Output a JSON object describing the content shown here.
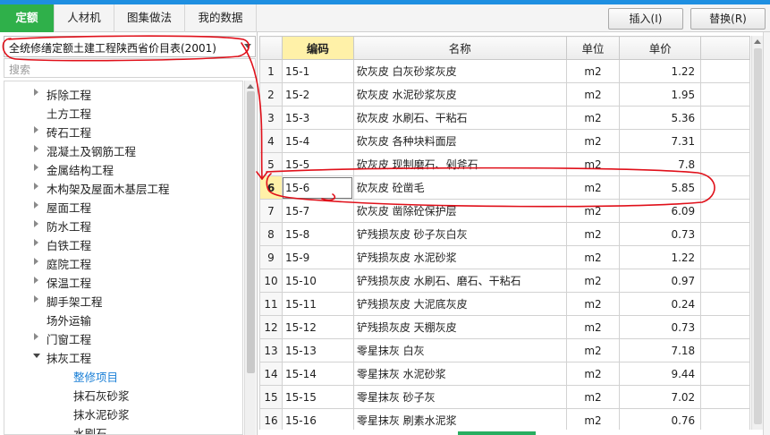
{
  "tabs": [
    {
      "label": "定额",
      "active": true
    },
    {
      "label": "人材机",
      "active": false
    },
    {
      "label": "图集做法",
      "active": false
    },
    {
      "label": "我的数据",
      "active": false
    }
  ],
  "buttons": {
    "insert": "插入(I)",
    "replace": "替换(R)"
  },
  "quota_book": "全统修缮定额土建工程陕西省价目表(2001)",
  "search_placeholder": "搜索",
  "tree": [
    {
      "label": "拆除工程",
      "children": true,
      "expanded": false,
      "level": 0
    },
    {
      "label": "土方工程",
      "children": false,
      "expanded": false,
      "level": 0
    },
    {
      "label": "砖石工程",
      "children": true,
      "expanded": false,
      "level": 0
    },
    {
      "label": "混凝土及钢筋工程",
      "children": true,
      "expanded": false,
      "level": 0
    },
    {
      "label": "金属结构工程",
      "children": true,
      "expanded": false,
      "level": 0
    },
    {
      "label": "木构架及屋面木基层工程",
      "children": true,
      "expanded": false,
      "level": 0
    },
    {
      "label": "屋面工程",
      "children": true,
      "expanded": false,
      "level": 0
    },
    {
      "label": "防水工程",
      "children": true,
      "expanded": false,
      "level": 0
    },
    {
      "label": "白铁工程",
      "children": true,
      "expanded": false,
      "level": 0
    },
    {
      "label": "庭院工程",
      "children": true,
      "expanded": false,
      "level": 0
    },
    {
      "label": "保温工程",
      "children": true,
      "expanded": false,
      "level": 0
    },
    {
      "label": "脚手架工程",
      "children": true,
      "expanded": false,
      "level": 0
    },
    {
      "label": "场外运输",
      "children": false,
      "expanded": false,
      "level": 0
    },
    {
      "label": "门窗工程",
      "children": true,
      "expanded": false,
      "level": 0
    },
    {
      "label": "抹灰工程",
      "children": true,
      "expanded": true,
      "level": 0
    },
    {
      "label": "整修项目",
      "children": false,
      "expanded": false,
      "level": 1,
      "selected": true
    },
    {
      "label": "抹石灰砂浆",
      "children": false,
      "expanded": false,
      "level": 1
    },
    {
      "label": "抹水泥砂浆",
      "children": false,
      "expanded": false,
      "level": 1
    },
    {
      "label": "水刷石",
      "children": false,
      "expanded": false,
      "level": 1
    }
  ],
  "table": {
    "headers": {
      "code": "编码",
      "name": "名称",
      "unit": "单位",
      "price": "单价"
    },
    "selected_row": 6,
    "rows": [
      {
        "n": "1",
        "code": "15-1",
        "name": "砍灰皮 白灰砂浆灰皮",
        "unit": "m2",
        "price": "1.22"
      },
      {
        "n": "2",
        "code": "15-2",
        "name": "砍灰皮 水泥砂浆灰皮",
        "unit": "m2",
        "price": "1.95"
      },
      {
        "n": "3",
        "code": "15-3",
        "name": "砍灰皮 水刷石、干粘石",
        "unit": "m2",
        "price": "5.36"
      },
      {
        "n": "4",
        "code": "15-4",
        "name": "砍灰皮 各种块料面层",
        "unit": "m2",
        "price": "7.31"
      },
      {
        "n": "5",
        "code": "15-5",
        "name": "砍灰皮 现制磨石、剁斧石",
        "unit": "m2",
        "price": "7.8"
      },
      {
        "n": "6",
        "code": "15-6",
        "name": "砍灰皮 砼凿毛",
        "unit": "m2",
        "price": "5.85"
      },
      {
        "n": "7",
        "code": "15-7",
        "name": "砍灰皮 凿除砼保护层",
        "unit": "m2",
        "price": "6.09"
      },
      {
        "n": "8",
        "code": "15-8",
        "name": "铲残损灰皮 砂子灰白灰",
        "unit": "m2",
        "price": "0.73"
      },
      {
        "n": "9",
        "code": "15-9",
        "name": "铲残损灰皮 水泥砂浆",
        "unit": "m2",
        "price": "1.22"
      },
      {
        "n": "10",
        "code": "15-10",
        "name": "铲残损灰皮 水刷石、磨石、干粘石",
        "unit": "m2",
        "price": "0.97"
      },
      {
        "n": "11",
        "code": "15-11",
        "name": "铲残损灰皮 大泥底灰皮",
        "unit": "m2",
        "price": "0.24"
      },
      {
        "n": "12",
        "code": "15-12",
        "name": "铲残损灰皮 天棚灰皮",
        "unit": "m2",
        "price": "0.73"
      },
      {
        "n": "13",
        "code": "15-13",
        "name": "零星抹灰 白灰",
        "unit": "m2",
        "price": "7.18"
      },
      {
        "n": "14",
        "code": "15-14",
        "name": "零星抹灰 水泥砂浆",
        "unit": "m2",
        "price": "9.44"
      },
      {
        "n": "15",
        "code": "15-15",
        "name": "零星抹灰 砂子灰",
        "unit": "m2",
        "price": "7.02"
      },
      {
        "n": "16",
        "code": "15-16",
        "name": "零星抹灰 刷素水泥浆",
        "unit": "m2",
        "price": "0.76"
      }
    ]
  },
  "colors": {
    "accent_green": "#2fb04a",
    "top_blue": "#1e8fe1",
    "selection_yellow": "#fff1a8",
    "annotation_red": "#e0101a"
  }
}
